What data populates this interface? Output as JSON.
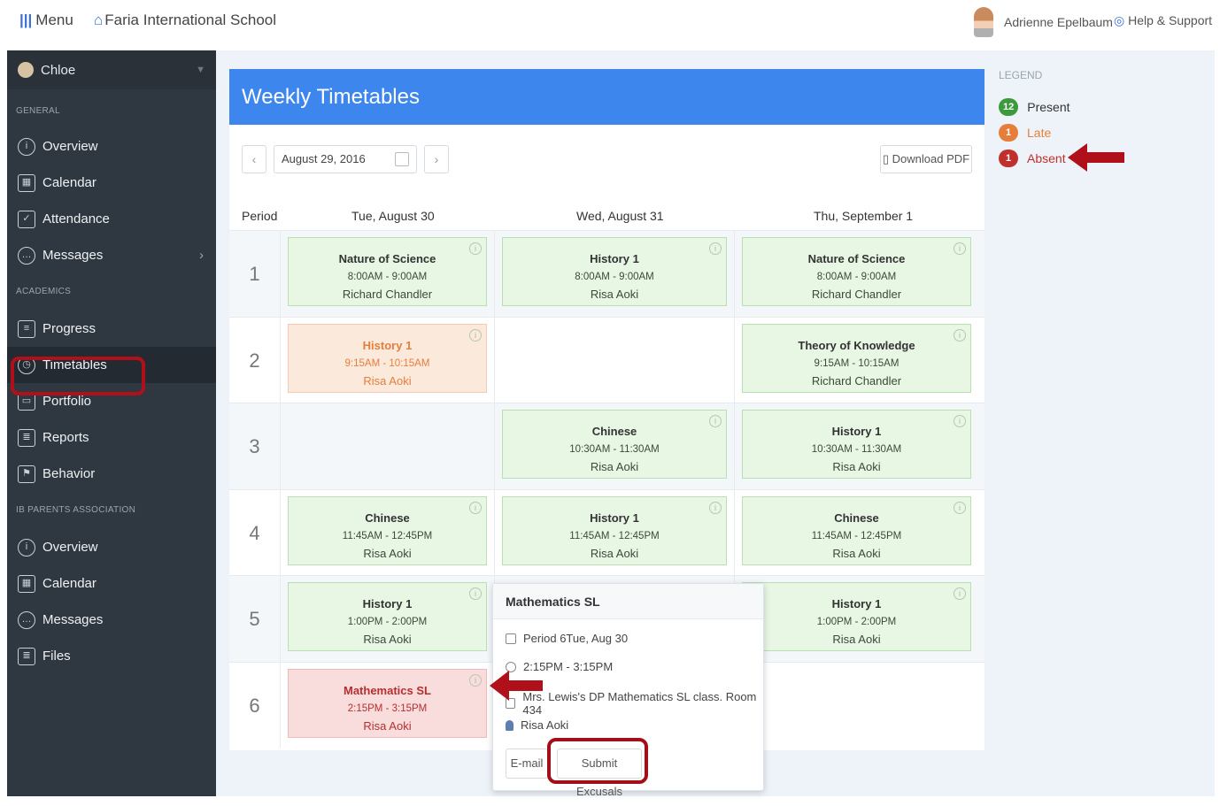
{
  "topbar": {
    "menu_label": "Menu",
    "school_name": "Faria International School",
    "user_name": "Adrienne Epelbaum",
    "help_label": "Help & Support"
  },
  "sidebar": {
    "student": "Chloe",
    "sections": {
      "general": "GENERAL",
      "academics": "ACADEMICS",
      "parents": "IB PARENTS ASSOCIATION"
    },
    "general_items": [
      "Overview",
      "Calendar",
      "Attendance",
      "Messages"
    ],
    "academic_items": [
      "Progress",
      "Timetables",
      "Portfolio",
      "Reports",
      "Behavior"
    ],
    "parent_items": [
      "Overview",
      "Calendar",
      "Messages",
      "Files"
    ]
  },
  "header": {
    "title": "Weekly Timetables",
    "date": "August 29, 2016",
    "download_label": "Download PDF"
  },
  "columns": {
    "period": "Period",
    "days": [
      "Tue, August 30",
      "Wed, August 31",
      "Thu, September 1"
    ]
  },
  "periods": [
    "1",
    "2",
    "3",
    "4",
    "5",
    "6"
  ],
  "classes": {
    "p1": [
      {
        "title": "Nature of Science",
        "time": "8:00AM - 9:00AM",
        "teacher": "Richard Chandler"
      },
      {
        "title": "History 1",
        "time": "8:00AM - 9:00AM",
        "teacher": "Risa Aoki"
      },
      {
        "title": "Nature of Science",
        "time": "8:00AM - 9:00AM",
        "teacher": "Richard Chandler"
      }
    ],
    "p2": [
      {
        "title": "History 1",
        "time": "9:15AM - 10:15AM",
        "teacher": "Risa Aoki",
        "status": "late"
      },
      {
        "title": "Theory of Knowledge",
        "time": "9:15AM - 10:15AM",
        "teacher": "Richard Chandler"
      }
    ],
    "p3": [
      {
        "title": "Chinese",
        "time": "10:30AM - 11:30AM",
        "teacher": "Risa Aoki"
      },
      {
        "title": "History 1",
        "time": "10:30AM - 11:30AM",
        "teacher": "Risa Aoki"
      }
    ],
    "p4": [
      {
        "title": "Chinese",
        "time": "11:45AM - 12:45PM",
        "teacher": "Risa Aoki"
      },
      {
        "title": "History 1",
        "time": "11:45AM - 12:45PM",
        "teacher": "Risa Aoki"
      },
      {
        "title": "Chinese",
        "time": "11:45AM - 12:45PM",
        "teacher": "Risa Aoki"
      }
    ],
    "p5": [
      {
        "title": "History 1",
        "time": "1:00PM - 2:00PM",
        "teacher": "Risa Aoki"
      },
      {
        "title": "History 1",
        "time": "1:00PM - 2:00PM",
        "teacher": "Risa Aoki"
      }
    ],
    "p6": [
      {
        "title": "Mathematics SL",
        "time": "2:15PM - 3:15PM",
        "teacher": "Risa Aoki",
        "status": "absent"
      }
    ]
  },
  "legend": {
    "title": "LEGEND",
    "present_count": "12",
    "present_label": "Present",
    "late_count": "1",
    "late_label": "Late",
    "absent_count": "1",
    "absent_label": "Absent",
    "colors": {
      "present": "#3c9a3c",
      "late": "#e67e3b",
      "absent": "#c0302c"
    }
  },
  "popover": {
    "title": "Mathematics SL",
    "period": "Period 6Tue, Aug 30",
    "time": "2:15PM - 3:15PM",
    "description": "Mrs. Lewis's DP Mathematics SL class. Room 434",
    "teacher": "Risa Aoki",
    "email_label": "E-mail",
    "excusal_label": "Submit Excusals"
  }
}
